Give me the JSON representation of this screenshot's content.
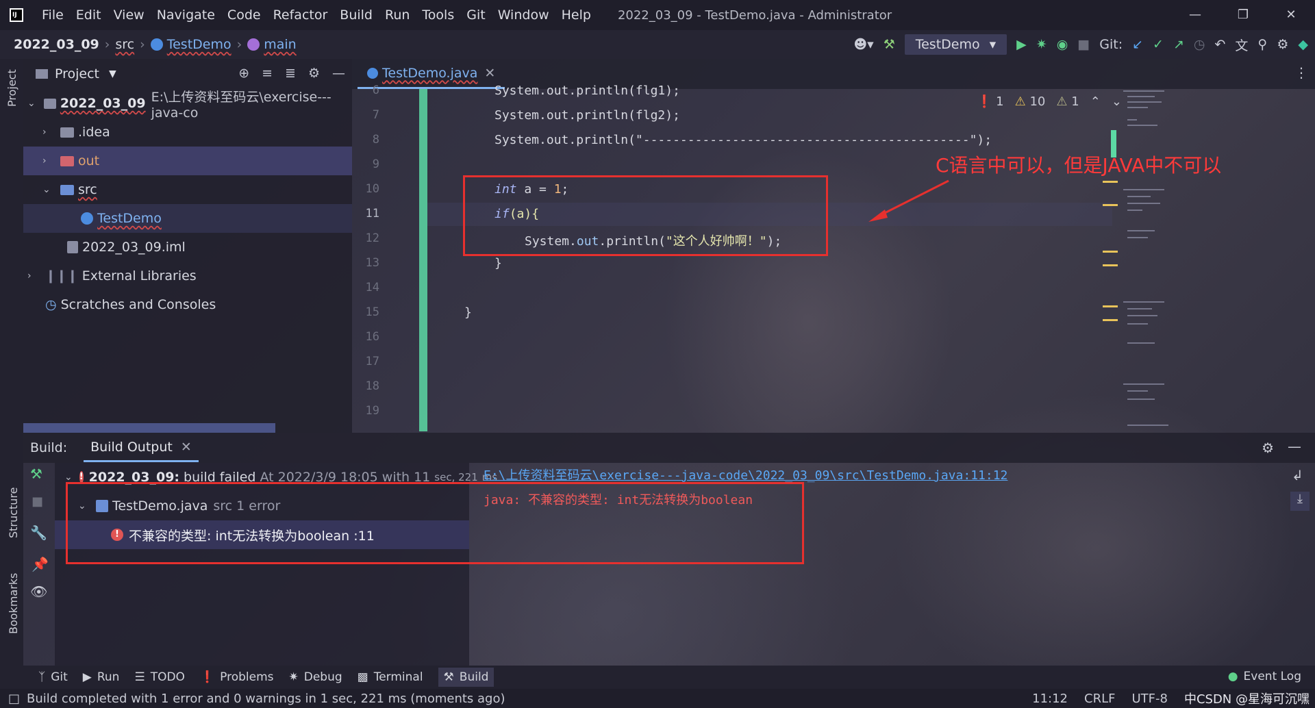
{
  "window": {
    "menu": [
      "File",
      "Edit",
      "View",
      "Navigate",
      "Code",
      "Refactor",
      "Build",
      "Run",
      "Tools",
      "Git",
      "Window",
      "Help"
    ],
    "title": "2022_03_09 - TestDemo.java - Administrator"
  },
  "navbar": {
    "project": "2022_03_09",
    "src": "src",
    "class": "TestDemo",
    "method": "main",
    "run_config": "TestDemo",
    "git_label": "Git:"
  },
  "sidebar": {
    "project_tab": "Project",
    "structure_tab": "Structure",
    "bookmarks_tab": "Bookmarks"
  },
  "project": {
    "header": "Project",
    "root_name": "2022_03_09",
    "root_path": "E:\\上传资料至码云\\exercise---java-co",
    "items": [
      ".idea",
      "out",
      "src",
      "TestDemo",
      "2022_03_09.iml",
      "External Libraries",
      "Scratches and Consoles"
    ]
  },
  "editor": {
    "tab": "TestDemo.java",
    "line_numbers": [
      "6",
      "7",
      "8",
      "9",
      "10",
      "11",
      "12",
      "13",
      "14",
      "15",
      "16",
      "17",
      "18",
      "19"
    ],
    "lines": {
      "l6": "System.out.println(flg1);",
      "l7": "System.out.println(flg2);",
      "l8": "System.out.println(\"--------------------------------------------\");",
      "l10_kw": "int",
      "l10_rest": " a = ",
      "l10_num": "1",
      "l10_end": ";",
      "l11_kw": "if",
      "l11_rest": "(a){",
      "l12_a": "System.",
      "l12_b": "out",
      "l12_c": ".println(",
      "l12_str": "\"这个人好帅啊！\"",
      "l12_end": ");",
      "l13": "}",
      "l15": "}"
    },
    "inspections": {
      "errors": "1",
      "warnings": "10",
      "weak": "1"
    }
  },
  "annotation": {
    "text": "C语言中可以，但是JAVA中不可以"
  },
  "build": {
    "label": "Build:",
    "tab": "Build Output",
    "summary_project": "2022_03_09:",
    "summary_status": "build failed",
    "summary_time": "At 2022/3/9 18:05 with",
    "summary_dur_a": "11",
    "summary_dur_b": "sec, 221",
    "summary_dur_c": "ms",
    "file": "TestDemo.java",
    "file_meta": "src 1 error",
    "error_msg": "不兼容的类型: int无法转换为boolean :11",
    "output_link": "E:\\上传资料至码云\\exercise---java-code\\2022_03_09\\src\\TestDemo.java:11:12",
    "output_error": "java: 不兼容的类型: int无法转换为boolean"
  },
  "tool_windows": [
    "Git",
    "Run",
    "TODO",
    "Problems",
    "Debug",
    "Terminal",
    "Build"
  ],
  "event_log": "Event Log",
  "status": {
    "message": "Build completed with 1 error and 0 warnings in 1 sec, 221 ms (moments ago)",
    "position": "11:12",
    "line_sep": "CRLF",
    "encoding": "UTF-8",
    "watermark": "中CSDN @星海可沉嘿"
  }
}
